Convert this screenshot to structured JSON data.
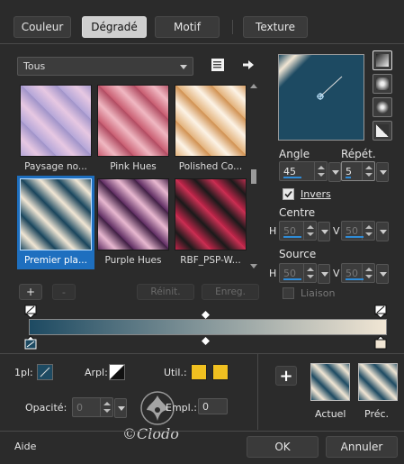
{
  "tabs": [
    {
      "label": "Couleur",
      "active": false
    },
    {
      "label": "Dégradé",
      "active": true
    },
    {
      "label": "Motif",
      "active": false
    },
    {
      "label": "Texture",
      "active": false
    }
  ],
  "filter": {
    "value": "Tous"
  },
  "gradients": [
    {
      "label": "Paysage no...",
      "colors": [
        "#b4a6d8",
        "#e7c8e2",
        "#9f93c9"
      ],
      "selected": false
    },
    {
      "label": "Pink Hues",
      "colors": [
        "#c85c70",
        "#f0b8c2",
        "#b04a60"
      ],
      "selected": false
    },
    {
      "label": "Polished Co...",
      "colors": [
        "#e3b27b",
        "#fcf3e6",
        "#d09050"
      ],
      "selected": false
    },
    {
      "label": "Premier pla...",
      "colors": [
        "#1d4a62",
        "#f1e6d4",
        "#174158"
      ],
      "selected": true
    },
    {
      "label": "Purple Hues",
      "colors": [
        "#5c2a60",
        "#e8b8d0",
        "#3c1c40"
      ],
      "selected": false
    },
    {
      "label": "RBF_PSP-W...",
      "colors": [
        "#c2254a",
        "#1a1a1a",
        "#d03055"
      ],
      "selected": false
    }
  ],
  "angle": {
    "label": "Angle",
    "value": "45"
  },
  "repeat": {
    "label": "Répét.",
    "value": "5"
  },
  "invert": {
    "label": "Invers",
    "checked": true
  },
  "center": {
    "label": "Centre",
    "h_label": "H",
    "h_value": "50",
    "v_label": "V",
    "v_value": "50"
  },
  "source": {
    "label": "Source",
    "h_label": "H",
    "h_value": "50",
    "v_label": "V",
    "v_value": "50"
  },
  "link": {
    "label": "Liaison"
  },
  "buttons": {
    "add": "+",
    "remove": "-",
    "reset": "Réinit.",
    "save": "Enreg.",
    "add_stop": "+",
    "help": "Aide",
    "ok": "OK",
    "cancel": "Annuler"
  },
  "gradient_bar": {
    "start_color": "#1d4a62",
    "end_color": "#f1e6d4"
  },
  "stops": {
    "first_label": "1pl:",
    "first_color": "#1d4a62",
    "arpl_label": "Arpl:",
    "util_label": "Util.:",
    "util_color": "#f0c020",
    "opacity_label": "Opacité:",
    "opacity_value": "0",
    "empl_label": "Empl.:",
    "empl_value": "0"
  },
  "preview": {
    "current_label": "Actuel",
    "prev_label": "Préc."
  },
  "watermark": "©Clodo"
}
